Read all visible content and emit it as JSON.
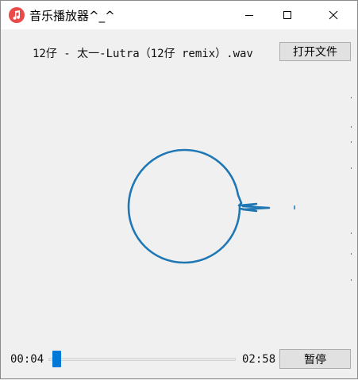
{
  "window": {
    "title": "音乐播放器^_^",
    "icon": "music-note-icon",
    "accent": "#e94b4b"
  },
  "player": {
    "filename": "12仔 - 太一-Lutra（12仔 remix）.wav",
    "open_label": "打开文件",
    "pause_label": "暂停",
    "current_time": "00:04",
    "total_time": "02:58",
    "progress": 0.022,
    "visualizer_color": "#1f77b4"
  }
}
